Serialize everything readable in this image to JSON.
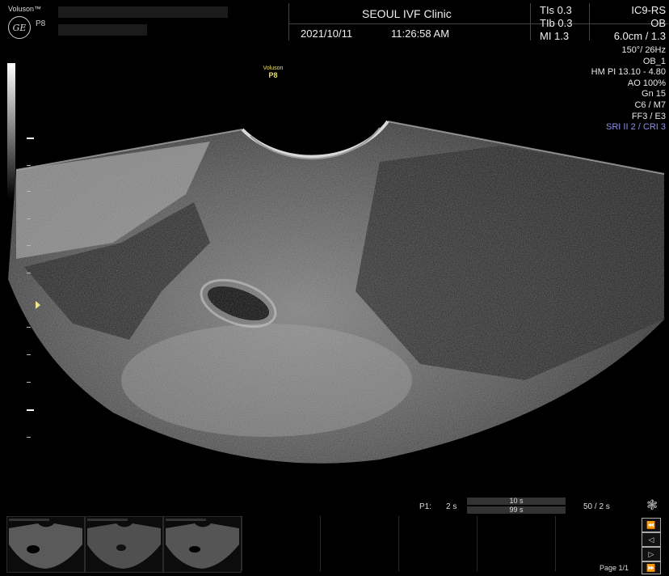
{
  "header": {
    "brand": "Voluson™",
    "logo_text": "GE",
    "probe_short": "P8",
    "clinic": "SEOUL IVF Clinic",
    "date": "2021/10/11",
    "time": "11:26:58 AM",
    "tis": "TIs 0.3",
    "tib": "TIb 0.3",
    "mi": "MI  1.3",
    "probe": "IC9-RS",
    "app": "OB",
    "depth": "6.0cm / 1.3"
  },
  "params": [
    "150°/ 26Hz",
    "OB_1",
    "HM PI 13.10 - 4.80",
    "AO 100%",
    "Gn  15",
    "C6 / M7",
    "FF3 / E3"
  ],
  "param_highlight": "SRI II 2 / CRI 3",
  "watermark": {
    "line1": "Voluson",
    "line2": "P8"
  },
  "cine": {
    "label": "P1:",
    "left_value": "2 s",
    "bar_top": "10 s",
    "bar_bottom": "99 s",
    "right_value": "50 / 2 s"
  },
  "footer": {
    "page": "Page 1/1"
  },
  "icons": {
    "gear": "settings-gear-icon",
    "first": "skip-back-icon",
    "prev": "prev-icon",
    "next": "next-icon",
    "last": "skip-forward-icon"
  },
  "colors": {
    "accent_blue": "#8f8fe8",
    "focus_marker": "#f0e68c",
    "watermark": "#e8e062"
  }
}
